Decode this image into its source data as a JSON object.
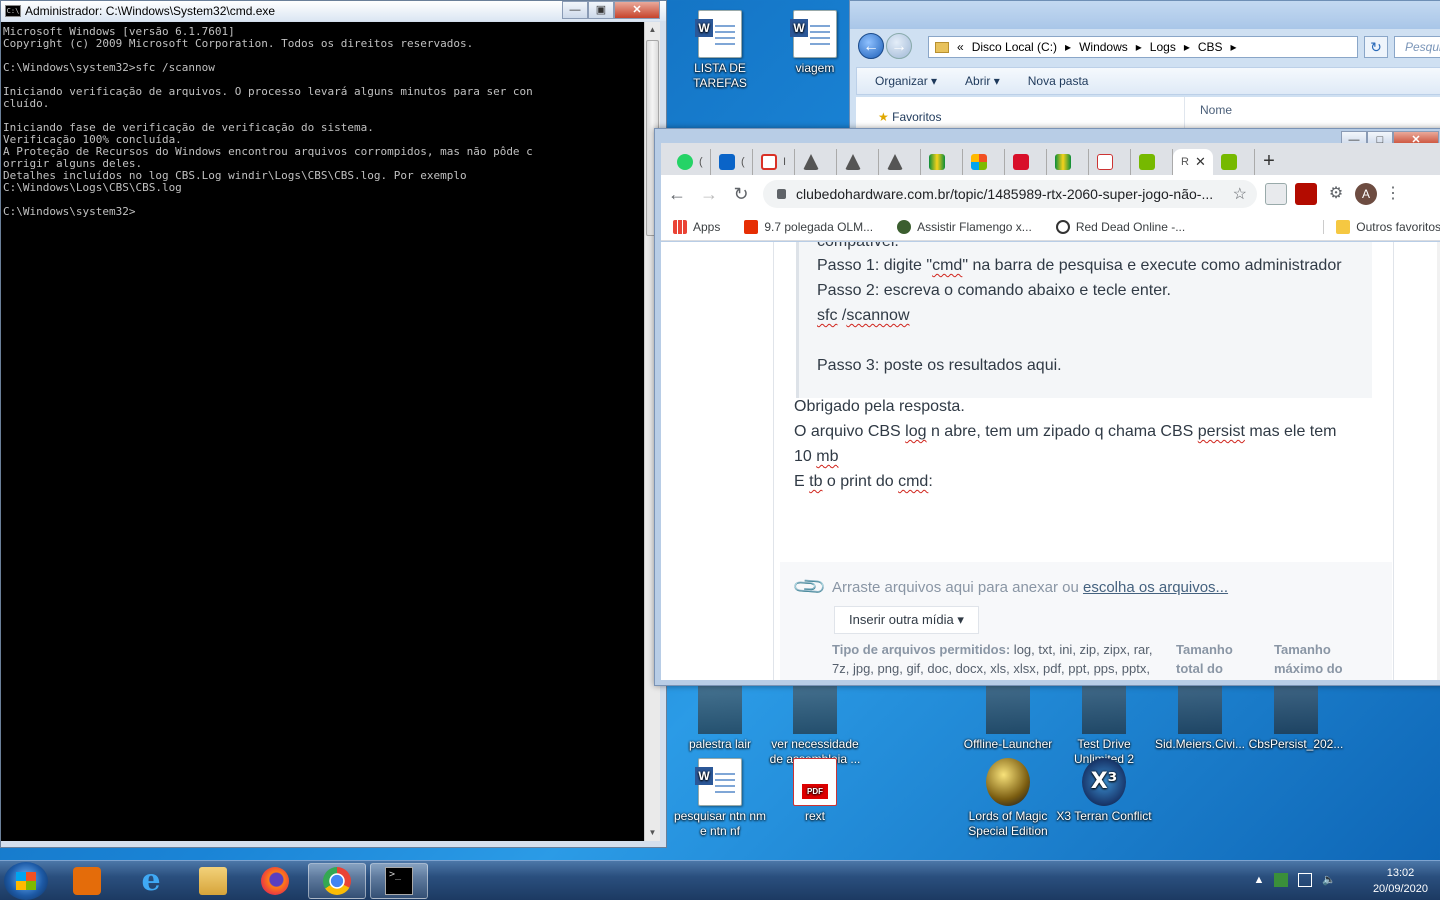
{
  "cmd_window": {
    "title": "Administrador: C:\\Windows\\System32\\cmd.exe",
    "console_text": "Microsoft Windows [versão 6.1.7601]\nCopyright (c) 2009 Microsoft Corporation. Todos os direitos reservados.\n\nC:\\Windows\\system32>sfc /scannow\n\nIniciando verificação de arquivos. O processo levará alguns minutos para ser con\ncluído.\n\nIniciando fase de verificação de verificação do sistema.\nVerificação 100% concluída.\nA Proteção de Recursos do Windows encontrou arquivos corrompidos, mas não pôde c\norrigir alguns deles.\nDetalhes incluídos no log CBS.Log windir\\Logs\\CBS\\CBS.log. Por exemplo\nC:\\Windows\\Logs\\CBS\\CBS.log\n\nC:\\Windows\\system32>"
  },
  "explorer": {
    "breadcrumb": [
      "«",
      "Disco Local (C:)",
      "Windows",
      "Logs",
      "CBS"
    ],
    "search_placeholder": "Pesqui",
    "commands": [
      "Organizar ▾",
      "Abrir ▾",
      "Nova pasta"
    ],
    "favorites": "Favoritos",
    "column_name": "Nome"
  },
  "chrome": {
    "active_tab_label": "R",
    "url": "clubedohardware.com.br/topic/1485989-rtx-2060-super-jogo-não-...",
    "profile_initial": "A",
    "bookmarks": [
      "Apps",
      "9.7 polegada OLM...",
      "Assistir Flamengo x...",
      "Red Dead Online -...",
      "Outros favoritos"
    ],
    "quote": {
      "partial": "compatível.",
      "step1_a": "Passo 1: digite \"",
      "step1_b": "cmd",
      "step1_c": "\" na barra de pesquisa e execute como administrador",
      "step2": "Passo 2: escreva o comando abaixo e tecle enter.",
      "cmd_a": "sfc",
      "cmd_b": " /",
      "cmd_c": "scannow",
      "step3": "Passo 3: poste os resultados aqui."
    },
    "reply": {
      "line1": "Obrigado pela resposta.",
      "line2_a": "O arquivo CBS ",
      "line2_b": "log",
      "line2_c": " n abre, tem um zipado q chama CBS ",
      "line2_d": "persist",
      "line2_e": " mas ele tem",
      "line3_a": "10 ",
      "line3_b": "mb",
      "line4_a": "E ",
      "line4_b": "tb",
      "line4_c": " o print do ",
      "line4_d": "cmd",
      "line4_e": ":"
    },
    "editor": {
      "drop_text": "Arraste arquivos aqui para anexar ou ",
      "choose_link": "escolha os arquivos...",
      "insert_media": "Inserir outra mídia ▾",
      "types_label": "Tipo de arquivos permitidos:",
      "types_list": " log, txt, ini, zip, zipx, rar, 7z, jpg, png, gif, doc, docx, xls, xlsx, pdf, ppt, pps, pptx,",
      "total_label": "Tamanho total do",
      "max_label": "Tamanho máximo do"
    }
  },
  "desktop_icons": {
    "lista": "LISTA DE TAREFAS",
    "viagem": "viagem",
    "palestra": "palestra lair",
    "assembleia": "ver necessidade de assembleia ...",
    "offline": "Offline-Launcher",
    "testdrive": "Test Drive Unlimited 2",
    "sid": "Sid.Meiers.Civi...",
    "cbs": "CbsPersist_202...",
    "pesquisar": "pesquisar ntn nm e ntn nf",
    "rext": "rext",
    "pdf_badge": "PDF",
    "lords": "Lords of Magic Special Edition",
    "x3": "X3 Terran Conflict"
  },
  "taskbar": {
    "time": "13:02",
    "date": "20/09/2020"
  }
}
